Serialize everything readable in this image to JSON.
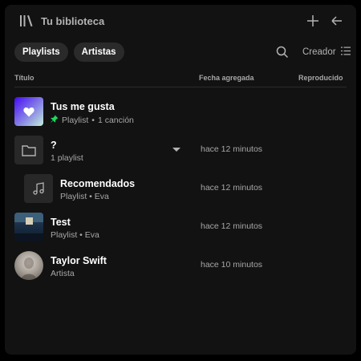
{
  "header": {
    "title": "Tu biblioteca",
    "icons": {
      "library": "library-icon",
      "add": "plus-icon",
      "back": "arrow-left-icon"
    }
  },
  "filters": {
    "chips": [
      "Playlists",
      "Artistas"
    ],
    "sort_label": "Creador"
  },
  "columns": {
    "title": "Título",
    "date_added": "Fecha agregada",
    "played": "Reproducido"
  },
  "items": [
    {
      "title": "Tus me gusta",
      "type": "Playlist",
      "subtitle_extra": "1 canción",
      "pinned": true,
      "date": "",
      "thumb": "heart-icon"
    },
    {
      "title": "?",
      "subtitle": "1 playlist",
      "date": "hace 12 minutos",
      "thumb": "folder-icon"
    },
    {
      "title": "Recomendados",
      "subtitle": "Playlist • Eva",
      "date": "hace 12 minutos",
      "thumb": "music-note-icon"
    },
    {
      "title": "Test",
      "subtitle": "Playlist • Eva",
      "date": "hace 12 minutos",
      "thumb": "cover-art"
    },
    {
      "title": "Taylor Swift",
      "subtitle": "Artista",
      "date": "hace 10 minutos",
      "thumb": "artist-photo"
    }
  ],
  "colors": {
    "accent_green": "#1ed760",
    "liked_gradient_start": "#450af5",
    "liked_gradient_end": "#c4efd9",
    "panel_bg": "#121212",
    "chip_bg": "#2a2a2a"
  }
}
